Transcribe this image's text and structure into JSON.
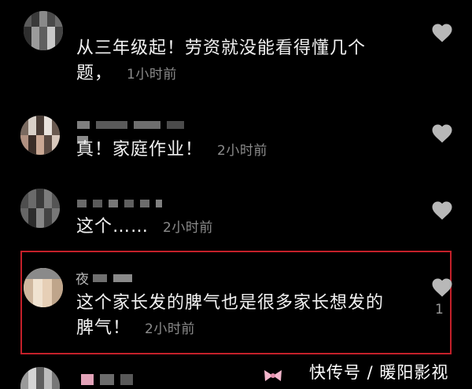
{
  "comments": [
    {
      "text_line1": "从三年级起！劳资就没能看得懂几个",
      "text_line2": "题，",
      "time": "1小时前"
    },
    {
      "text_line1": "真！家庭作业！",
      "time": "2小时前"
    },
    {
      "text_line1": "这个……",
      "time": "2小时前"
    },
    {
      "username_visible": "夜",
      "text_line1": "这个家长发的脾气也是很多家长想发的",
      "text_line2": "脾气！",
      "time": "2小时前",
      "likes": "1"
    }
  ],
  "watermark": "快传号 / 暖阳影视",
  "icons": {
    "like": "heart-icon",
    "decor": "bow-emoji-icon"
  },
  "colors": {
    "background": "#000000",
    "text": "#f2f2f2",
    "time": "#8b8b8b",
    "highlight": "#c4202a",
    "heart": "#b8b8b8"
  }
}
